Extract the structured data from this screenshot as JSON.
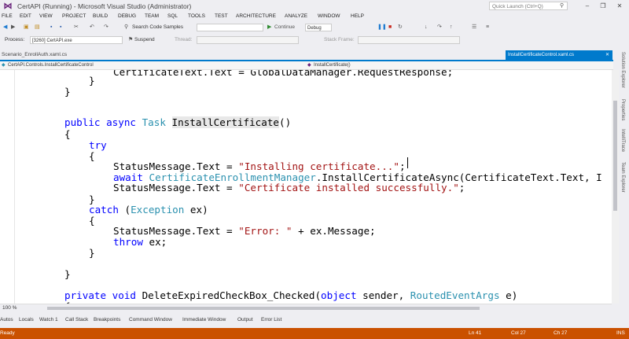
{
  "window": {
    "title": "CertAPI (Running) - Microsoft Visual Studio (Administrator)",
    "quick_launch_placeholder": "Quick Launch (Ctrl+Q)"
  },
  "menu": [
    "FILE",
    "EDIT",
    "VIEW",
    "PROJECT",
    "BUILD",
    "DEBUG",
    "TEAM",
    "SQL",
    "TOOLS",
    "TEST",
    "ARCHITECTURE",
    "ANALYZE",
    "WINDOW",
    "HELP"
  ],
  "toolbar": {
    "search_samples": "Search Code Samples",
    "continue": "Continue",
    "config": "Debug",
    "process_label": "Process:",
    "process_value": "[3260] CertAPI.exe",
    "suspend": "Suspend",
    "thread_label": "Thread:",
    "stack_frame_label": "Stack Frame:"
  },
  "tabs": {
    "left_doc": "Scenario_EnrollAuth.xaml.cs",
    "active_doc": "InstallCertificateControl.xaml.cs",
    "nav_class": "CertAPI.Controls.InstallCertificateControl",
    "nav_member": "InstallCertificate()"
  },
  "code": {
    "l1": "CertificateText.Text = GlobalDataManager.RequestResponse;",
    "l2": "}",
    "l3": "}",
    "l4_kw": "public async",
    "l4_ty": "Task",
    "l4_fn": "InstallCertificate",
    "l4_tail": "()",
    "l5": "{",
    "l6": "try",
    "l7": "{",
    "l8_a": "StatusMessage.Text = ",
    "l8_s": "\"Installing certificate...\"",
    "l8_b": ";",
    "l9_kw": "await",
    "l9_ty": "CertificateEnrollmentManager",
    "l9_b": ".InstallCertificateAsync(CertificateText.Text, I",
    "l10_a": "StatusMessage.Text = ",
    "l10_s": "\"Certificate installed successfully.\"",
    "l10_b": ";",
    "l11": "}",
    "l12_kw": "catch",
    "l12_a": " (",
    "l12_ty": "Exception",
    "l12_b": " ex)",
    "l13": "{",
    "l14_a": "StatusMessage.Text = ",
    "l14_s": "\"Error: \"",
    "l14_b": " + ex.Message;",
    "l15_kw": "throw",
    "l15_b": " ex;",
    "l16": "}",
    "l17": "}",
    "l18_kw": "private void",
    "l18_a": " DeleteExpiredCheckBox_Checked(",
    "l18_kw2": "object",
    "l18_b": " sender, ",
    "l18_ty": "RoutedEventArgs",
    "l18_c": " e)",
    "l19": "{"
  },
  "side_panels": [
    "Solution Explorer",
    "Properties",
    "IntelliTrace",
    "Team Explorer"
  ],
  "zoom": "100 %",
  "bottom_tabs": [
    "Autos",
    "Locals",
    "Watch 1",
    "Call Stack",
    "Breakpoints",
    "Command Window",
    "Immediate Window",
    "Output",
    "Error List"
  ],
  "status": {
    "text": "Ready",
    "line": "Ln 41",
    "col": "Col 27",
    "ch": "Ch 27",
    "mode": "INS"
  },
  "colors": {
    "accent": "#007acc",
    "status_bar": "#ca5100",
    "keyword": "#0000ff",
    "type": "#2b91af",
    "string": "#a31515"
  }
}
